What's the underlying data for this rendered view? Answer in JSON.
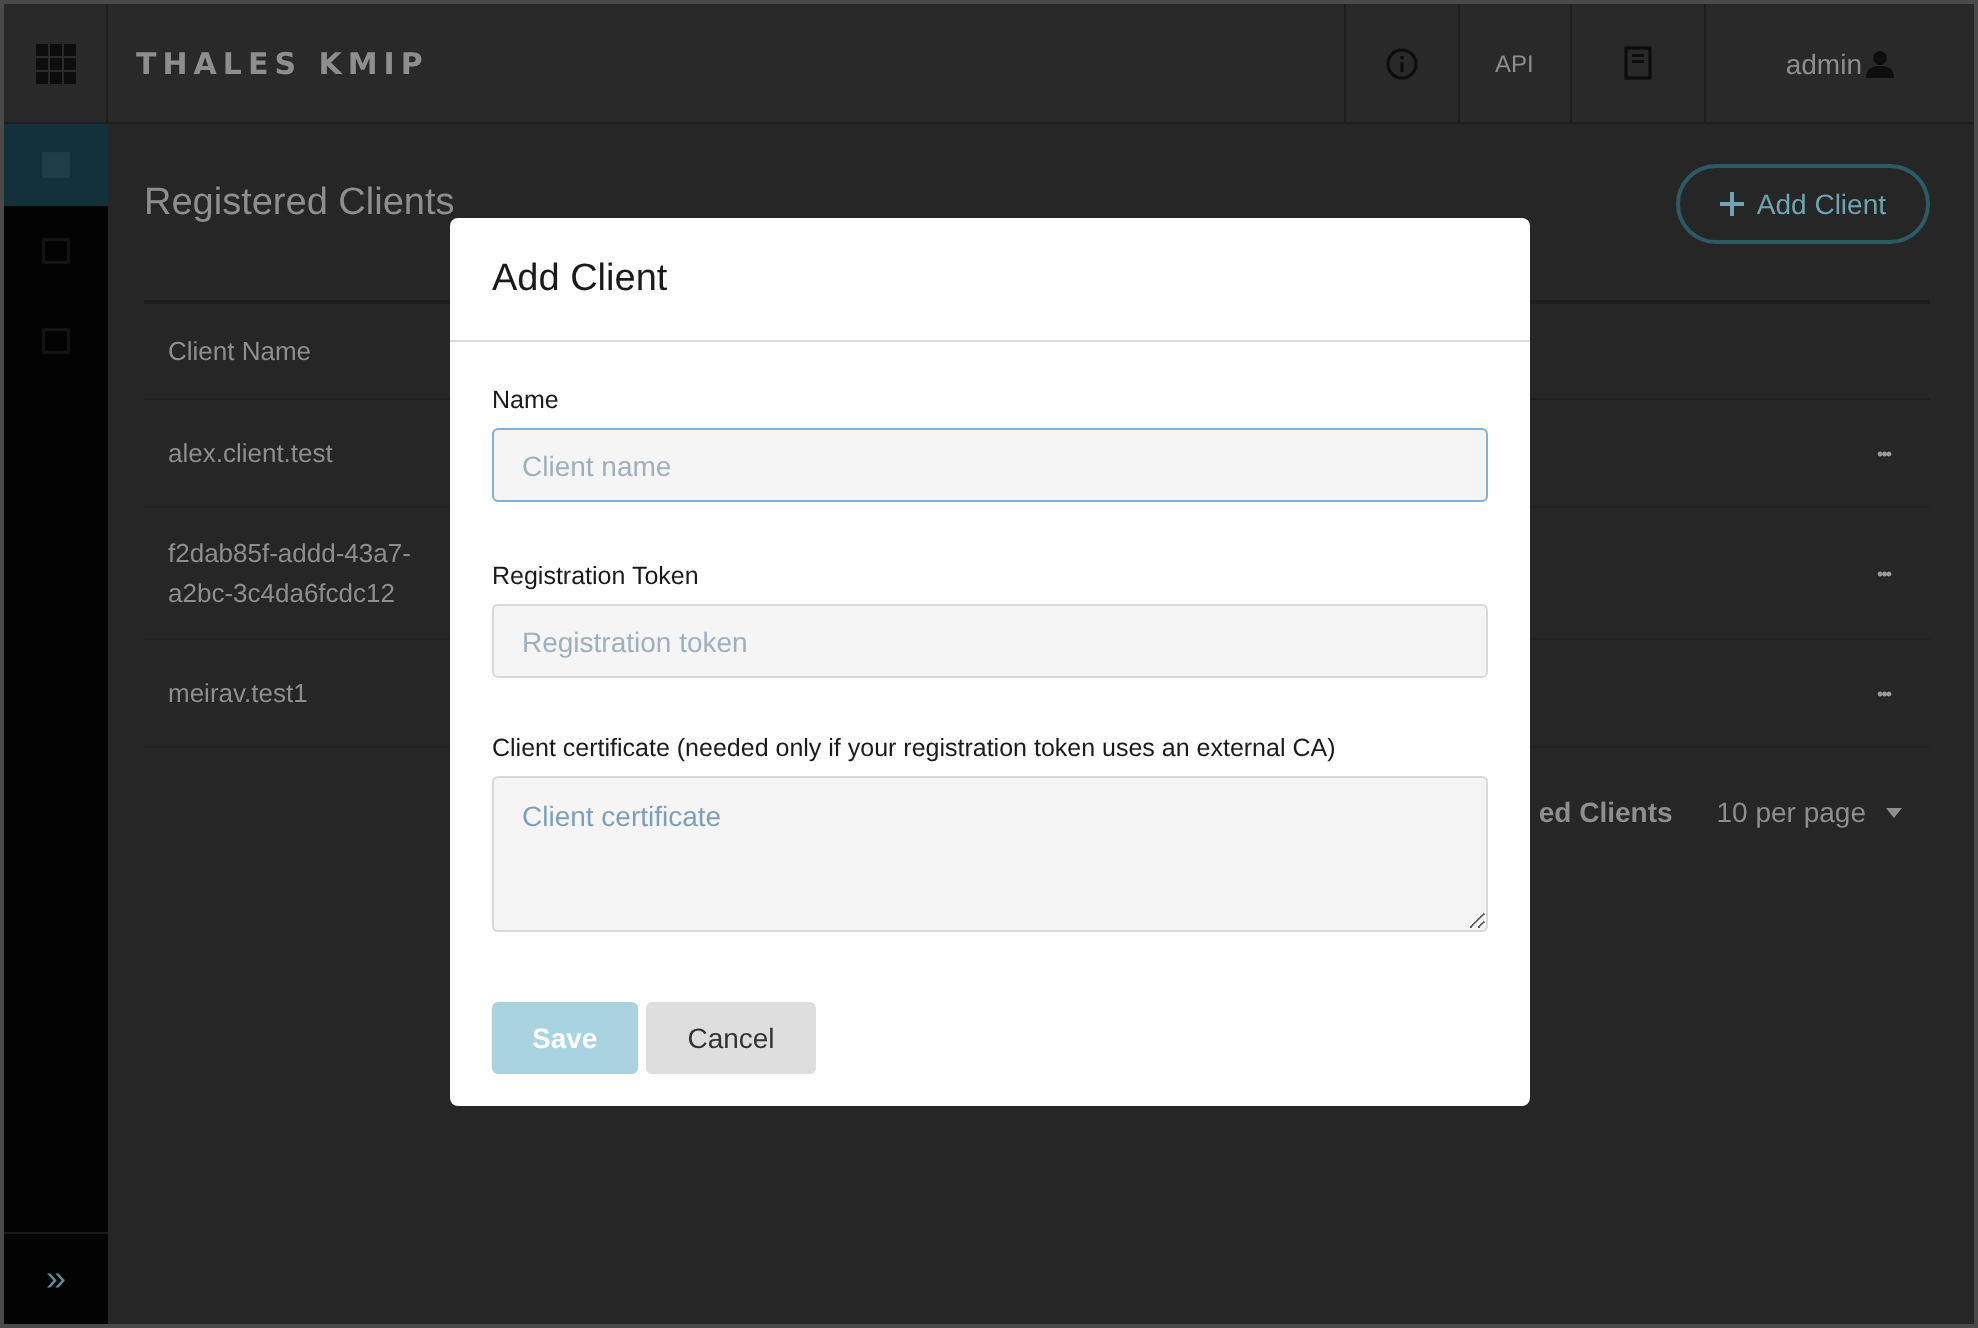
{
  "header": {
    "logo": "THALES KMIP",
    "api_label": "API",
    "user": "admin"
  },
  "sidebar": {
    "items": [
      {
        "selected": true
      },
      {
        "selected": false
      },
      {
        "selected": false
      }
    ],
    "expand": "»"
  },
  "page": {
    "title": "Registered Clients",
    "add_button": "Add Client"
  },
  "table": {
    "columns": [
      "Client Name"
    ],
    "rows": [
      {
        "name": "alex.client.test",
        "menu": "•••"
      },
      {
        "name": "f2dab85f-addd-43a7-a2bc-3c4da6fcdc12",
        "menu": "•••"
      },
      {
        "name": "meirav.test1",
        "menu": "•••"
      }
    ],
    "footer": {
      "count_label": "ed Clients",
      "per_page": "10 per page"
    }
  },
  "dialog": {
    "title": "Add Client",
    "fields": [
      {
        "kind": "input",
        "label": "Name",
        "placeholder": "Client name",
        "focused": true
      },
      {
        "kind": "input",
        "label": "Registration Token",
        "placeholder": "Registration token",
        "focused": false
      },
      {
        "kind": "textarea",
        "label": "Client certificate (needed only if your registration token uses an external CA)",
        "placeholder": "Client certificate",
        "focused": false
      }
    ],
    "buttons": [
      {
        "kind": "primary",
        "label": "Save",
        "disabled": true
      },
      {
        "kind": "secondary",
        "label": "Cancel",
        "disabled": false
      }
    ]
  }
}
